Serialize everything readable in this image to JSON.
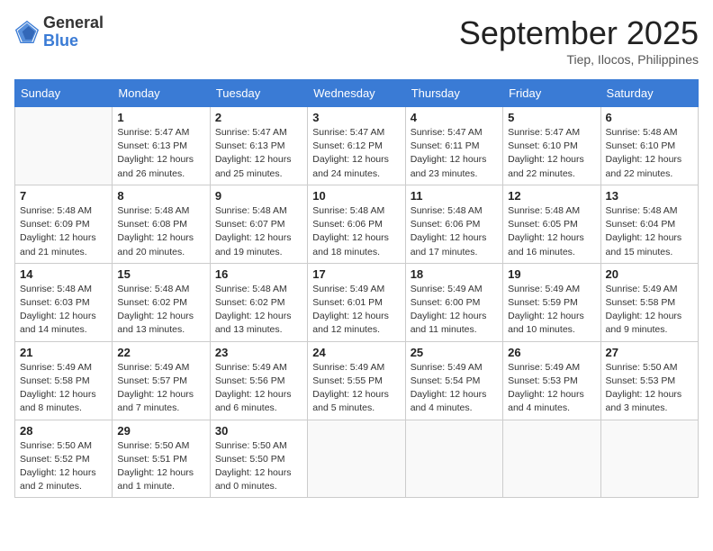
{
  "header": {
    "logo_general": "General",
    "logo_blue": "Blue",
    "month_title": "September 2025",
    "subtitle": "Tiep, Ilocos, Philippines"
  },
  "days_of_week": [
    "Sunday",
    "Monday",
    "Tuesday",
    "Wednesday",
    "Thursday",
    "Friday",
    "Saturday"
  ],
  "weeks": [
    [
      {
        "day": "",
        "sunrise": "",
        "sunset": "",
        "daylight": ""
      },
      {
        "day": "1",
        "sunrise": "Sunrise: 5:47 AM",
        "sunset": "Sunset: 6:13 PM",
        "daylight": "Daylight: 12 hours and 26 minutes."
      },
      {
        "day": "2",
        "sunrise": "Sunrise: 5:47 AM",
        "sunset": "Sunset: 6:13 PM",
        "daylight": "Daylight: 12 hours and 25 minutes."
      },
      {
        "day": "3",
        "sunrise": "Sunrise: 5:47 AM",
        "sunset": "Sunset: 6:12 PM",
        "daylight": "Daylight: 12 hours and 24 minutes."
      },
      {
        "day": "4",
        "sunrise": "Sunrise: 5:47 AM",
        "sunset": "Sunset: 6:11 PM",
        "daylight": "Daylight: 12 hours and 23 minutes."
      },
      {
        "day": "5",
        "sunrise": "Sunrise: 5:47 AM",
        "sunset": "Sunset: 6:10 PM",
        "daylight": "Daylight: 12 hours and 22 minutes."
      },
      {
        "day": "6",
        "sunrise": "Sunrise: 5:48 AM",
        "sunset": "Sunset: 6:10 PM",
        "daylight": "Daylight: 12 hours and 22 minutes."
      }
    ],
    [
      {
        "day": "7",
        "sunrise": "Sunrise: 5:48 AM",
        "sunset": "Sunset: 6:09 PM",
        "daylight": "Daylight: 12 hours and 21 minutes."
      },
      {
        "day": "8",
        "sunrise": "Sunrise: 5:48 AM",
        "sunset": "Sunset: 6:08 PM",
        "daylight": "Daylight: 12 hours and 20 minutes."
      },
      {
        "day": "9",
        "sunrise": "Sunrise: 5:48 AM",
        "sunset": "Sunset: 6:07 PM",
        "daylight": "Daylight: 12 hours and 19 minutes."
      },
      {
        "day": "10",
        "sunrise": "Sunrise: 5:48 AM",
        "sunset": "Sunset: 6:06 PM",
        "daylight": "Daylight: 12 hours and 18 minutes."
      },
      {
        "day": "11",
        "sunrise": "Sunrise: 5:48 AM",
        "sunset": "Sunset: 6:06 PM",
        "daylight": "Daylight: 12 hours and 17 minutes."
      },
      {
        "day": "12",
        "sunrise": "Sunrise: 5:48 AM",
        "sunset": "Sunset: 6:05 PM",
        "daylight": "Daylight: 12 hours and 16 minutes."
      },
      {
        "day": "13",
        "sunrise": "Sunrise: 5:48 AM",
        "sunset": "Sunset: 6:04 PM",
        "daylight": "Daylight: 12 hours and 15 minutes."
      }
    ],
    [
      {
        "day": "14",
        "sunrise": "Sunrise: 5:48 AM",
        "sunset": "Sunset: 6:03 PM",
        "daylight": "Daylight: 12 hours and 14 minutes."
      },
      {
        "day": "15",
        "sunrise": "Sunrise: 5:48 AM",
        "sunset": "Sunset: 6:02 PM",
        "daylight": "Daylight: 12 hours and 13 minutes."
      },
      {
        "day": "16",
        "sunrise": "Sunrise: 5:48 AM",
        "sunset": "Sunset: 6:02 PM",
        "daylight": "Daylight: 12 hours and 13 minutes."
      },
      {
        "day": "17",
        "sunrise": "Sunrise: 5:49 AM",
        "sunset": "Sunset: 6:01 PM",
        "daylight": "Daylight: 12 hours and 12 minutes."
      },
      {
        "day": "18",
        "sunrise": "Sunrise: 5:49 AM",
        "sunset": "Sunset: 6:00 PM",
        "daylight": "Daylight: 12 hours and 11 minutes."
      },
      {
        "day": "19",
        "sunrise": "Sunrise: 5:49 AM",
        "sunset": "Sunset: 5:59 PM",
        "daylight": "Daylight: 12 hours and 10 minutes."
      },
      {
        "day": "20",
        "sunrise": "Sunrise: 5:49 AM",
        "sunset": "Sunset: 5:58 PM",
        "daylight": "Daylight: 12 hours and 9 minutes."
      }
    ],
    [
      {
        "day": "21",
        "sunrise": "Sunrise: 5:49 AM",
        "sunset": "Sunset: 5:58 PM",
        "daylight": "Daylight: 12 hours and 8 minutes."
      },
      {
        "day": "22",
        "sunrise": "Sunrise: 5:49 AM",
        "sunset": "Sunset: 5:57 PM",
        "daylight": "Daylight: 12 hours and 7 minutes."
      },
      {
        "day": "23",
        "sunrise": "Sunrise: 5:49 AM",
        "sunset": "Sunset: 5:56 PM",
        "daylight": "Daylight: 12 hours and 6 minutes."
      },
      {
        "day": "24",
        "sunrise": "Sunrise: 5:49 AM",
        "sunset": "Sunset: 5:55 PM",
        "daylight": "Daylight: 12 hours and 5 minutes."
      },
      {
        "day": "25",
        "sunrise": "Sunrise: 5:49 AM",
        "sunset": "Sunset: 5:54 PM",
        "daylight": "Daylight: 12 hours and 4 minutes."
      },
      {
        "day": "26",
        "sunrise": "Sunrise: 5:49 AM",
        "sunset": "Sunset: 5:53 PM",
        "daylight": "Daylight: 12 hours and 4 minutes."
      },
      {
        "day": "27",
        "sunrise": "Sunrise: 5:50 AM",
        "sunset": "Sunset: 5:53 PM",
        "daylight": "Daylight: 12 hours and 3 minutes."
      }
    ],
    [
      {
        "day": "28",
        "sunrise": "Sunrise: 5:50 AM",
        "sunset": "Sunset: 5:52 PM",
        "daylight": "Daylight: 12 hours and 2 minutes."
      },
      {
        "day": "29",
        "sunrise": "Sunrise: 5:50 AM",
        "sunset": "Sunset: 5:51 PM",
        "daylight": "Daylight: 12 hours and 1 minute."
      },
      {
        "day": "30",
        "sunrise": "Sunrise: 5:50 AM",
        "sunset": "Sunset: 5:50 PM",
        "daylight": "Daylight: 12 hours and 0 minutes."
      },
      {
        "day": "",
        "sunrise": "",
        "sunset": "",
        "daylight": ""
      },
      {
        "day": "",
        "sunrise": "",
        "sunset": "",
        "daylight": ""
      },
      {
        "day": "",
        "sunrise": "",
        "sunset": "",
        "daylight": ""
      },
      {
        "day": "",
        "sunrise": "",
        "sunset": "",
        "daylight": ""
      }
    ]
  ]
}
